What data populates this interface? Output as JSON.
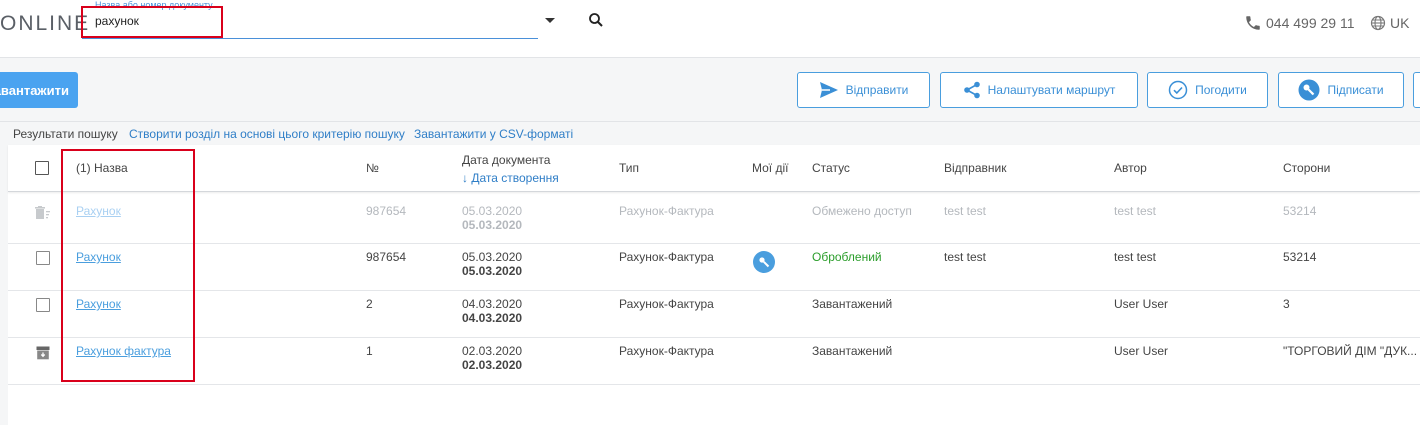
{
  "header": {
    "logo": "ONLINE",
    "search": {
      "float_label": "Назва або номер документу",
      "value": "рахунок"
    },
    "phone": "044 499 29 11",
    "language": "UK"
  },
  "toolbar": {
    "upload_label": "авантажити",
    "send_label": "Відправити",
    "route_label": "Налаштувати маршрут",
    "approve_label": "Погодити",
    "sign_label": "Підписати"
  },
  "results_bar": {
    "label": "Результати пошуку",
    "create_section_link": "Створити розділ на основі цього критерію пошуку",
    "csv_link": "Завантажити у CSV-форматі"
  },
  "table": {
    "headers": {
      "name": "(1) Назва",
      "number": "№",
      "doc_date": "Дата документа",
      "created_date": "↓ Дата створення",
      "type": "Тип",
      "my_actions": "Мої дії",
      "status": "Статус",
      "sender": "Відправник",
      "author": "Автор",
      "parties": "Сторони"
    },
    "rows": [
      {
        "name": "Рахунок",
        "number": "987654",
        "doc_date": "05.03.2020",
        "created_date": "05.03.2020",
        "type": "Рахунок-Фактура",
        "status": "Обмежено доступ",
        "sender": "test test",
        "author": "test test",
        "parties": "53214"
      },
      {
        "name": "Рахунок",
        "number": "987654",
        "doc_date": "05.03.2020",
        "created_date": "05.03.2020",
        "type": "Рахунок-Фактура",
        "status": "Оброблений",
        "sender": "test test",
        "author": "test test",
        "parties": "53214"
      },
      {
        "name": "Рахунок",
        "number": "2",
        "doc_date": "04.03.2020",
        "created_date": "04.03.2020",
        "type": "Рахунок-Фактура",
        "status": "Завантажений",
        "sender": "",
        "author": "User User",
        "parties": "3"
      },
      {
        "name": "Рахунок фактура",
        "number": "1",
        "doc_date": "02.03.2020",
        "created_date": "02.03.2020",
        "type": "Рахунок-Фактура",
        "status": "Завантажений",
        "sender": "",
        "author": "User User",
        "parties": "\"ТОРГОВИЙ ДІМ \"ДУК..."
      }
    ]
  },
  "colors": {
    "accent": "#4a9ede",
    "link": "#2f7ec7",
    "highlight": "#d9001b",
    "status_ok": "#2a9d2a"
  }
}
